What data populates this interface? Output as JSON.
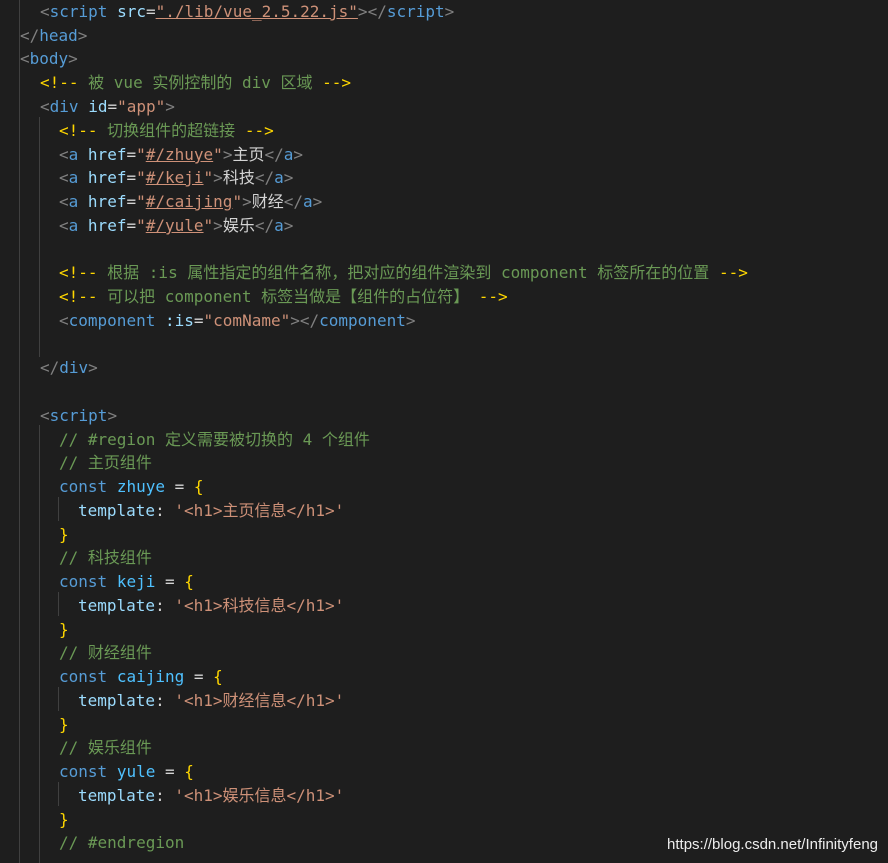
{
  "code": {
    "l1": {
      "open": "<",
      "tag": "script",
      "attr": "src",
      "eq": "=",
      "val": "\"./lib/vue_2.5.22.js\"",
      "close1": ">",
      "close2": "</",
      "tag2": "script",
      "close3": ">"
    },
    "l2": {
      "open": "</",
      "tag": "head",
      "close": ">"
    },
    "l3": {
      "open": "<",
      "tag": "body",
      "close": ">"
    },
    "l4": {
      "open": "<!--",
      "text": " 被 vue 实例控制的 div 区域 ",
      "close": "-->"
    },
    "l5": {
      "open": "<",
      "tag": "div",
      "attr": "id",
      "eq": "=",
      "val": "\"app\"",
      "close": ">"
    },
    "l6": {
      "open": "<!--",
      "text": " 切换组件的超链接 ",
      "close": "-->"
    },
    "l7": {
      "open": "<",
      "tag": "a",
      "attr": "href",
      "eq": "=",
      "q1": "\"",
      "href": "#/zhuye",
      "q2": "\"",
      "close1": ">",
      "text": "主页",
      "close2": "</",
      "tag2": "a",
      "close3": ">"
    },
    "l8": {
      "open": "<",
      "tag": "a",
      "attr": "href",
      "eq": "=",
      "q1": "\"",
      "href": "#/keji",
      "q2": "\"",
      "close1": ">",
      "text": "科技",
      "close2": "</",
      "tag2": "a",
      "close3": ">"
    },
    "l9": {
      "open": "<",
      "tag": "a",
      "attr": "href",
      "eq": "=",
      "q1": "\"",
      "href": "#/caijing",
      "q2": "\"",
      "close1": ">",
      "text": "财经",
      "close2": "</",
      "tag2": "a",
      "close3": ">"
    },
    "l10": {
      "open": "<",
      "tag": "a",
      "attr": "href",
      "eq": "=",
      "q1": "\"",
      "href": "#/yule",
      "q2": "\"",
      "close1": ">",
      "text": "娱乐",
      "close2": "</",
      "tag2": "a",
      "close3": ">"
    },
    "l12": {
      "open": "<!--",
      "text": " 根据 :is 属性指定的组件名称，把对应的组件渲染到 component 标签所在的位置 ",
      "close": "-->"
    },
    "l13": {
      "open": "<!--",
      "text": " 可以把 component 标签当做是【组件的占位符】 ",
      "close": "-->"
    },
    "l14": {
      "open": "<",
      "tag": "component",
      "attr": ":is",
      "eq": "=",
      "val": "\"comName\"",
      "close1": ">",
      "close2": "</",
      "tag2": "component",
      "close3": ">"
    },
    "l16": {
      "open": "</",
      "tag": "div",
      "close": ">"
    },
    "l18": {
      "open": "<",
      "tag": "script",
      "close": ">"
    },
    "l19": {
      "text": "// #region 定义需要被切换的 4 个组件"
    },
    "l20": {
      "text": "// 主页组件"
    },
    "l21": {
      "kw": "const",
      "name": "zhuye",
      "eq": " = ",
      "brace": "{"
    },
    "l22": {
      "prop": "template",
      "colon": ": ",
      "str": "'<h1>主页信息</h1>'"
    },
    "l23": {
      "brace": "}"
    },
    "l24": {
      "text": "// 科技组件"
    },
    "l25": {
      "kw": "const",
      "name": "keji",
      "eq": " = ",
      "brace": "{"
    },
    "l26": {
      "prop": "template",
      "colon": ": ",
      "str": "'<h1>科技信息</h1>'"
    },
    "l27": {
      "brace": "}"
    },
    "l28": {
      "text": "// 财经组件"
    },
    "l29": {
      "kw": "const",
      "name": "caijing",
      "eq": " = ",
      "brace": "{"
    },
    "l30": {
      "prop": "template",
      "colon": ": ",
      "str": "'<h1>财经信息</h1>'"
    },
    "l31": {
      "brace": "}"
    },
    "l32": {
      "text": "// 娱乐组件"
    },
    "l33": {
      "kw": "const",
      "name": "yule",
      "eq": " = ",
      "brace": "{"
    },
    "l34": {
      "prop": "template",
      "colon": ": ",
      "str": "'<h1>娱乐信息</h1>'"
    },
    "l35": {
      "brace": "}"
    },
    "l36": {
      "text": "// #endregion"
    }
  },
  "watermark": "https://blog.csdn.net/Infinityfeng"
}
